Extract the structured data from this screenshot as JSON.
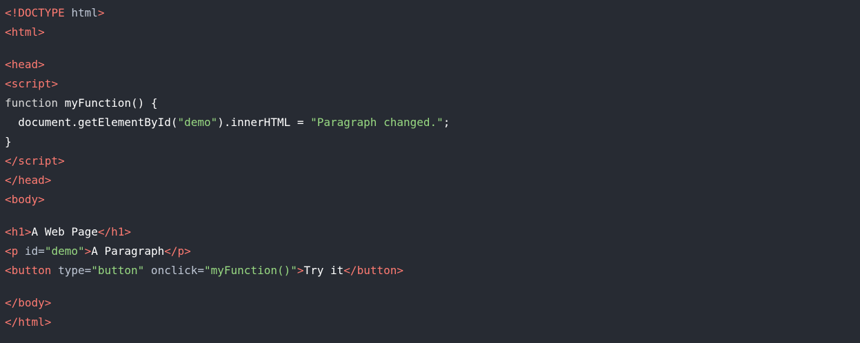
{
  "colors": {
    "background": "#272b33",
    "tag": "#ff7b72",
    "string": "#98d982",
    "text": "#ffffff"
  },
  "code_lines": [
    [
      {
        "t": "<",
        "c": "tag"
      },
      {
        "t": "!DOCTYPE",
        "c": "tag"
      },
      {
        "t": " html",
        "c": "attr"
      },
      {
        "t": ">",
        "c": "tag"
      }
    ],
    [
      {
        "t": "<",
        "c": "tag"
      },
      {
        "t": "html",
        "c": "tag"
      },
      {
        "t": ">",
        "c": "tag"
      }
    ],
    null,
    [
      {
        "t": "<",
        "c": "tag"
      },
      {
        "t": "head",
        "c": "tag"
      },
      {
        "t": ">",
        "c": "tag"
      }
    ],
    [
      {
        "t": "<",
        "c": "tag"
      },
      {
        "t": "script",
        "c": "tag"
      },
      {
        "t": ">",
        "c": "tag"
      }
    ],
    [
      {
        "t": "function",
        "c": "keyword"
      },
      {
        "t": " myFunction() {",
        "c": "plain"
      }
    ],
    [
      {
        "t": "  document.getElementById(",
        "c": "plain"
      },
      {
        "t": "\"demo\"",
        "c": "string"
      },
      {
        "t": ").innerHTML = ",
        "c": "plain"
      },
      {
        "t": "\"Paragraph changed.\"",
        "c": "string"
      },
      {
        "t": ";",
        "c": "plain"
      }
    ],
    [
      {
        "t": "}",
        "c": "plain"
      }
    ],
    [
      {
        "t": "</",
        "c": "tag"
      },
      {
        "t": "script",
        "c": "tag"
      },
      {
        "t": ">",
        "c": "tag"
      }
    ],
    [
      {
        "t": "</",
        "c": "tag"
      },
      {
        "t": "head",
        "c": "tag"
      },
      {
        "t": ">",
        "c": "tag"
      }
    ],
    [
      {
        "t": "<",
        "c": "tag"
      },
      {
        "t": "body",
        "c": "tag"
      },
      {
        "t": ">",
        "c": "tag"
      }
    ],
    null,
    [
      {
        "t": "<",
        "c": "tag"
      },
      {
        "t": "h1",
        "c": "tag"
      },
      {
        "t": ">",
        "c": "tag"
      },
      {
        "t": "A Web Page",
        "c": "plain"
      },
      {
        "t": "</",
        "c": "tag"
      },
      {
        "t": "h1",
        "c": "tag"
      },
      {
        "t": ">",
        "c": "tag"
      }
    ],
    [
      {
        "t": "<",
        "c": "tag"
      },
      {
        "t": "p",
        "c": "tag"
      },
      {
        "t": " id=",
        "c": "attr"
      },
      {
        "t": "\"demo\"",
        "c": "string"
      },
      {
        "t": ">",
        "c": "tag"
      },
      {
        "t": "A Paragraph",
        "c": "plain"
      },
      {
        "t": "</",
        "c": "tag"
      },
      {
        "t": "p",
        "c": "tag"
      },
      {
        "t": ">",
        "c": "tag"
      }
    ],
    [
      {
        "t": "<",
        "c": "tag"
      },
      {
        "t": "button",
        "c": "tag"
      },
      {
        "t": " type=",
        "c": "attr"
      },
      {
        "t": "\"button\"",
        "c": "string"
      },
      {
        "t": " onclick=",
        "c": "attr"
      },
      {
        "t": "\"myFunction()\"",
        "c": "string"
      },
      {
        "t": ">",
        "c": "tag"
      },
      {
        "t": "Try it",
        "c": "plain"
      },
      {
        "t": "</",
        "c": "tag"
      },
      {
        "t": "button",
        "c": "tag"
      },
      {
        "t": ">",
        "c": "tag"
      }
    ],
    null,
    [
      {
        "t": "</",
        "c": "tag"
      },
      {
        "t": "body",
        "c": "tag"
      },
      {
        "t": ">",
        "c": "tag"
      }
    ],
    [
      {
        "t": "</",
        "c": "tag"
      },
      {
        "t": "html",
        "c": "tag"
      },
      {
        "t": ">",
        "c": "tag"
      }
    ]
  ]
}
